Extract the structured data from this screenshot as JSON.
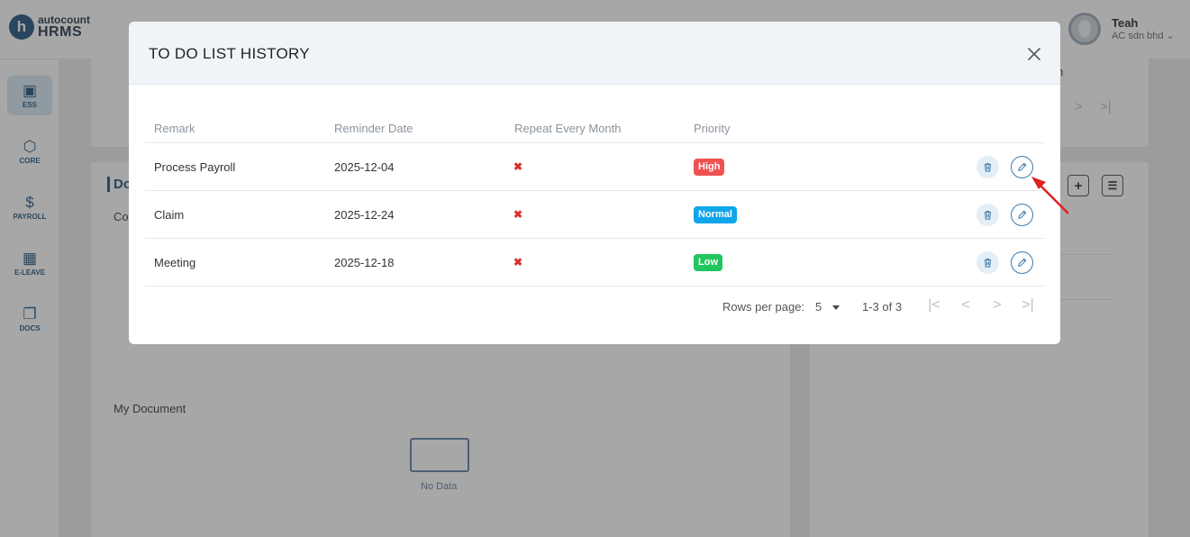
{
  "app": {
    "logo_sub": "autocount",
    "logo_main": "HRMS",
    "logo_letter": "h"
  },
  "user": {
    "name": "Teah",
    "company": "AC sdn bhd ⌄"
  },
  "sidebar": {
    "items": [
      {
        "label": "ESS",
        "icon": "person-card-icon",
        "glyph": "▣"
      },
      {
        "label": "CORE",
        "icon": "cube-icon",
        "glyph": "⬡"
      },
      {
        "label": "PAYROLL",
        "icon": "dollar-icon",
        "glyph": "$"
      },
      {
        "label": "E-LEAVE",
        "icon": "calendar-icon",
        "glyph": "▦"
      },
      {
        "label": "DOCS",
        "icon": "document-icon",
        "glyph": "❐"
      }
    ]
  },
  "background": {
    "card_left_heading": "Do",
    "card_left_sub": "Co",
    "right_fragment": "h",
    "my_document": "My Document",
    "no_data": "No Data"
  },
  "modal": {
    "title": "TO DO LIST HISTORY",
    "columns": [
      "Remark",
      "Reminder Date",
      "Repeat Every Month",
      "Priority"
    ],
    "rows": [
      {
        "remark": "Process Payroll",
        "date": "2025-12-04",
        "repeat": "✖",
        "priority": "High",
        "priority_color": "#f05252"
      },
      {
        "remark": "Claim",
        "date": "2025-12-24",
        "repeat": "✖",
        "priority": "Normal",
        "priority_color": "#0ea5e9"
      },
      {
        "remark": "Meeting",
        "date": "2025-12-18",
        "repeat": "✖",
        "priority": "Low",
        "priority_color": "#22c55e"
      }
    ],
    "pagination": {
      "rows_per_page_label": "Rows per page:",
      "rows_per_page_value": "5",
      "range": "1-3 of 3",
      "first": "|<",
      "prev": "<",
      "next": ">",
      "last": ">|"
    }
  },
  "colors": {
    "accent": "#1a4f7a",
    "annotation_arrow": "#e02020"
  }
}
